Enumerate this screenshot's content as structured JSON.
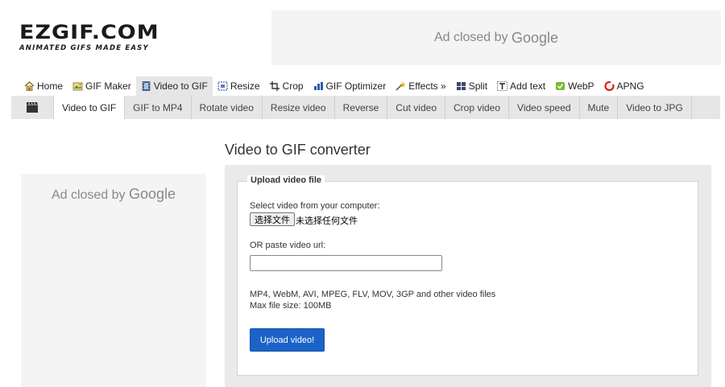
{
  "logo": {
    "main": "EZGIF.COM",
    "tagline": "ANIMATED GIFS MADE EASY"
  },
  "ads": {
    "top": {
      "closed_text": "Ad closed by",
      "brand": "Google"
    },
    "left": {
      "closed_text": "Ad closed by",
      "brand": "Google"
    }
  },
  "main_nav": [
    {
      "label": "Home",
      "icon": "home-icon"
    },
    {
      "label": "GIF Maker",
      "icon": "gif-maker-icon"
    },
    {
      "label": "Video to GIF",
      "icon": "film-icon",
      "active": true
    },
    {
      "label": "Resize",
      "icon": "resize-icon"
    },
    {
      "label": "Crop",
      "icon": "crop-icon"
    },
    {
      "label": "GIF Optimizer",
      "icon": "optimizer-icon"
    },
    {
      "label": "Effects »",
      "icon": "effects-icon"
    },
    {
      "label": "Split",
      "icon": "split-icon"
    },
    {
      "label": "Add text",
      "icon": "add-text-icon"
    },
    {
      "label": "WebP",
      "icon": "webp-icon"
    },
    {
      "label": "APNG",
      "icon": "apng-icon"
    }
  ],
  "sub_nav": [
    {
      "label": "Video to GIF",
      "active": true
    },
    {
      "label": "GIF to MP4"
    },
    {
      "label": "Rotate video"
    },
    {
      "label": "Resize video"
    },
    {
      "label": "Reverse"
    },
    {
      "label": "Cut video"
    },
    {
      "label": "Crop video"
    },
    {
      "label": "Video speed"
    },
    {
      "label": "Mute"
    },
    {
      "label": "Video to JPG"
    }
  ],
  "page_title": "Video to GIF converter",
  "upload_form": {
    "legend": "Upload video file",
    "select_label": "Select video from your computer:",
    "file_button": "选择文件",
    "file_status": "未选择任何文件",
    "url_label": "OR paste video url:",
    "url_value": "",
    "formats_text": "MP4, WebM, AVI, MPEG, FLV, MOV, 3GP and other video files",
    "max_size_text": "Max file size: 100MB",
    "submit_label": "Upload video!"
  },
  "colors": {
    "accent": "#1c63c7",
    "nav_bg": "#e6e6e6",
    "panel_bg": "#eaeaea"
  }
}
